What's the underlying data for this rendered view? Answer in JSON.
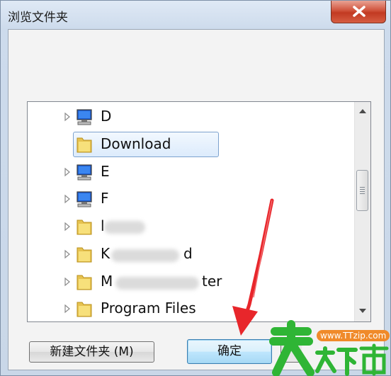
{
  "window": {
    "title": "浏览文件夹",
    "close_icon": "close-icon"
  },
  "tree": {
    "items": [
      {
        "label": "D",
        "icon": "drive-icon",
        "expandable": true
      },
      {
        "label": "Download",
        "icon": "folder-icon",
        "expandable": false,
        "selected": true
      },
      {
        "label": "E",
        "icon": "drive-icon",
        "expandable": true
      },
      {
        "label": "F",
        "icon": "drive-icon",
        "expandable": true
      },
      {
        "label": "l",
        "icon": "folder-icon",
        "expandable": true
      },
      {
        "label": "K",
        "icon": "folder-icon",
        "expandable": true,
        "suffix": "d"
      },
      {
        "label": "M",
        "icon": "folder-icon",
        "expandable": true,
        "suffix": "ter"
      },
      {
        "label": "Program Files",
        "icon": "folder-icon",
        "expandable": true
      }
    ]
  },
  "buttons": {
    "new_folder": "新建文件夹 (M)",
    "ok": "确定"
  },
  "watermark": {
    "text": "www.TTzip.com",
    "logo_text": "天下载"
  },
  "colors": {
    "annotation_arrow": "#e8262b",
    "watermark_green": "#2fb535"
  }
}
